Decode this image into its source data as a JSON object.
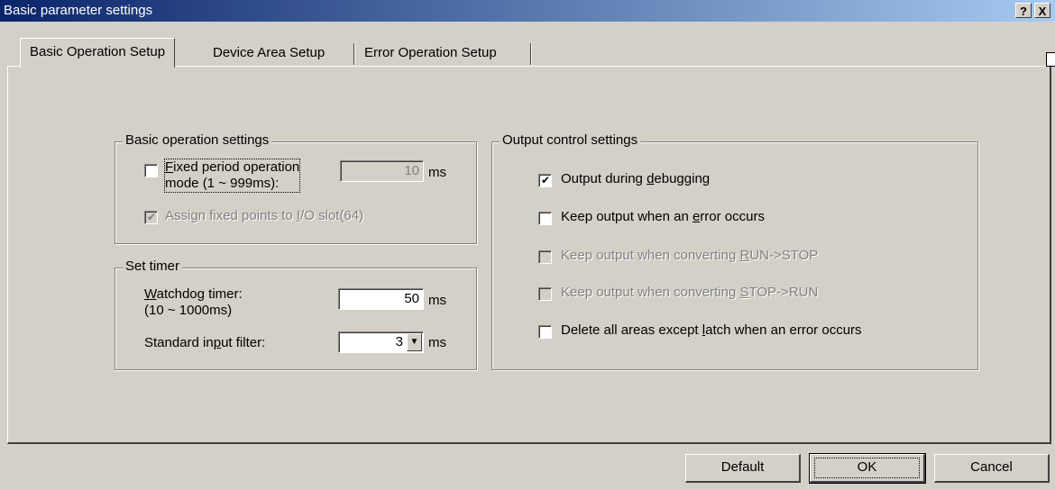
{
  "window": {
    "title": "Basic parameter settings",
    "help_label": "?",
    "close_label": "X"
  },
  "tabs": [
    {
      "label": "Basic Operation Setup",
      "active": true
    },
    {
      "label": "Device Area Setup",
      "active": false
    },
    {
      "label": "Error Operation Setup",
      "active": false
    }
  ],
  "basic_operation": {
    "group_title": "Basic operation settings",
    "fixed_period": {
      "label_accel": "F",
      "label_rest": "ixed period operation",
      "label_line2": "mode (1 ~ 999ms):",
      "checked": false,
      "value": "10",
      "unit": "ms"
    },
    "assign_fixed_points": {
      "label_pre": "Assign fixed points to ",
      "label_accel": "I",
      "label_post": "/O slot(64)",
      "checked": true,
      "disabled": true
    }
  },
  "set_timer": {
    "group_title": "Set timer",
    "watchdog": {
      "label_accel": "W",
      "label_rest": "atchdog timer:",
      "label_line2": "(10 ~ 1000ms)",
      "value": "50",
      "unit": "ms"
    },
    "input_filter": {
      "label_pre": "Standard in",
      "label_accel": "p",
      "label_post": "ut filter:",
      "value": "3",
      "unit": "ms"
    }
  },
  "output_control": {
    "group_title": "Output control settings",
    "items": [
      {
        "pre": "Output during ",
        "accel": "d",
        "post": "ebugging",
        "checked": true,
        "disabled": false
      },
      {
        "pre": "Keep output when an ",
        "accel": "e",
        "post": "rror occurs",
        "checked": false,
        "disabled": false
      },
      {
        "pre": "Keep output when converting ",
        "accel": "R",
        "post": "UN->STOP",
        "checked": false,
        "disabled": true
      },
      {
        "pre": "Keep output when converting ",
        "accel": "S",
        "post": "TOP->RUN",
        "checked": false,
        "disabled": true
      },
      {
        "pre": "Delete all areas except ",
        "accel": "l",
        "post": "atch when an error occurs",
        "checked": false,
        "disabled": false
      }
    ]
  },
  "buttons": {
    "default_label": "Default",
    "ok_label": "OK",
    "cancel_label": "Cancel"
  },
  "icons": {
    "checkmark": "✔",
    "dropdown_arrow": "▼"
  }
}
